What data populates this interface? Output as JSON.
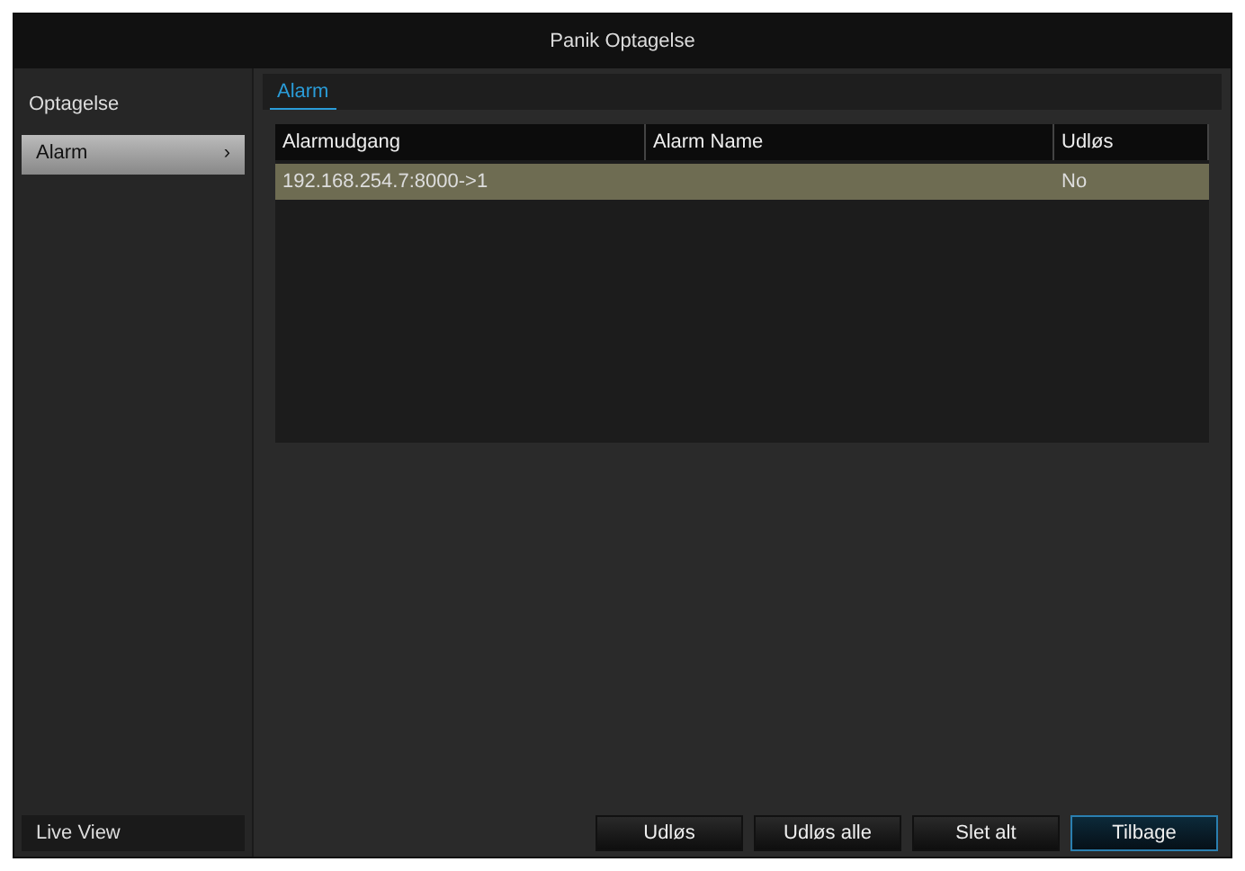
{
  "window": {
    "title": "Panik Optagelse"
  },
  "sidebar": {
    "heading": "Optagelse",
    "items": [
      {
        "label": "Alarm",
        "arrow": "›",
        "selected": true
      }
    ],
    "footer": "Live View"
  },
  "tabs": [
    {
      "label": "Alarm",
      "selected": true
    }
  ],
  "table": {
    "columns": [
      "Alarmudgang",
      "Alarm Name",
      "Udløs"
    ],
    "rows": [
      {
        "cells": [
          "192.168.254.7:8000->1",
          "",
          "No"
        ],
        "selected": true
      }
    ]
  },
  "buttons": [
    {
      "label": "Udløs",
      "selected": false
    },
    {
      "label": "Udløs alle",
      "selected": false
    },
    {
      "label": "Slet alt",
      "selected": false
    },
    {
      "label": "Tilbage",
      "selected": true
    }
  ]
}
